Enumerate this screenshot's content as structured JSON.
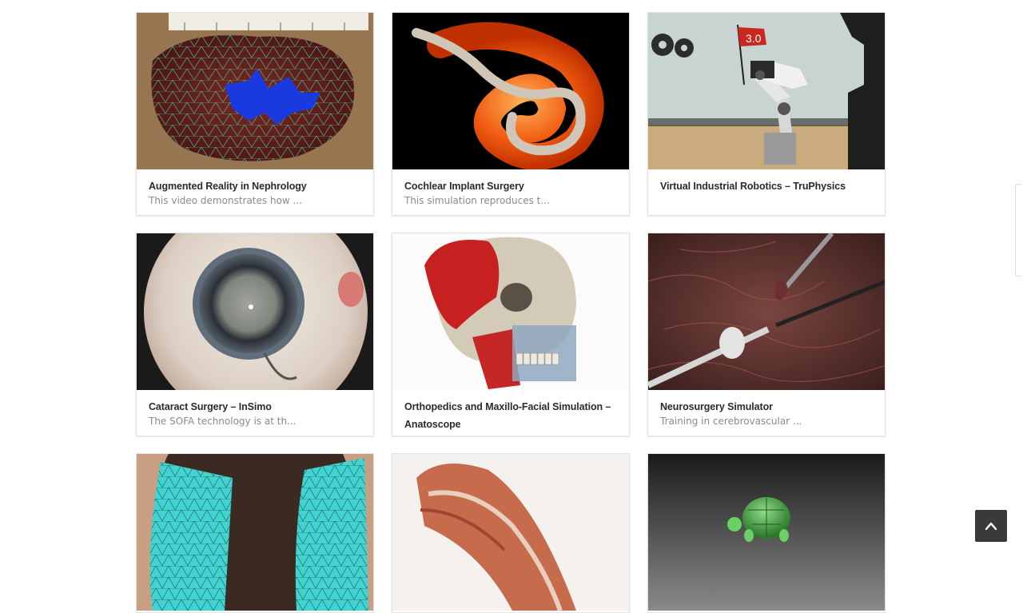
{
  "cards": [
    {
      "title": "Augmented Reality in Nephrology",
      "excerpt": "This video demonstrates how ...",
      "thumb": "kidney-mesh-image"
    },
    {
      "title": "Cochlear Implant Surgery",
      "excerpt": "This simulation reproduces t...",
      "thumb": "cochlea-implant-image"
    },
    {
      "title": "Virtual Industrial Robotics – TruPhysics",
      "excerpt": "",
      "thumb": "industrial-robot-illustration",
      "badge": "3.0"
    },
    {
      "title": "Cataract Surgery – InSimo",
      "excerpt": "The SOFA technology is at th...",
      "thumb": "eye-surgery-image"
    },
    {
      "title": "Orthopedics and Maxillo-Facial Simulation – Anatoscope",
      "excerpt": "",
      "thumb": "skull-muscle-image"
    },
    {
      "title": "Neurosurgery Simulator",
      "excerpt": "Training in cerebrovascular ...",
      "thumb": "brain-surgery-image"
    },
    {
      "title": "",
      "excerpt": "",
      "thumb": "tissue-mesh-image"
    },
    {
      "title": "",
      "excerpt": "",
      "thumb": "arm-muscle-image"
    },
    {
      "title": "",
      "excerpt": "",
      "thumb": "turtle-model-image"
    }
  ],
  "scroll_top": {
    "icon": "chevron-up-icon"
  },
  "colors": {
    "card_border": "#e2e2e2",
    "title": "#2b2b2b",
    "excerpt": "#8a8a8a",
    "scroll_button": "#3a3a3a"
  }
}
